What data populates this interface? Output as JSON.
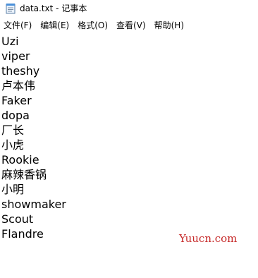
{
  "window": {
    "title": "data.txt - 记事本"
  },
  "menubar": {
    "items": [
      {
        "label": "文件(F)",
        "name": "menu-file"
      },
      {
        "label": "编辑(E)",
        "name": "menu-edit"
      },
      {
        "label": "格式(O)",
        "name": "menu-format"
      },
      {
        "label": "查看(V)",
        "name": "menu-view"
      },
      {
        "label": "帮助(H)",
        "name": "menu-help"
      }
    ]
  },
  "editor": {
    "lines": [
      "Uzi",
      "viper",
      "theshy",
      "卢本伟",
      "Faker",
      "dopa",
      "厂长",
      "小虎",
      "Rookie",
      "麻辣香锅",
      "小明",
      "showmaker",
      "Scout",
      "Flandre"
    ]
  },
  "watermark": {
    "text": "Yuucn.com",
    "color": "#c62828"
  },
  "icons": {
    "app_icon": "notepad-icon"
  }
}
